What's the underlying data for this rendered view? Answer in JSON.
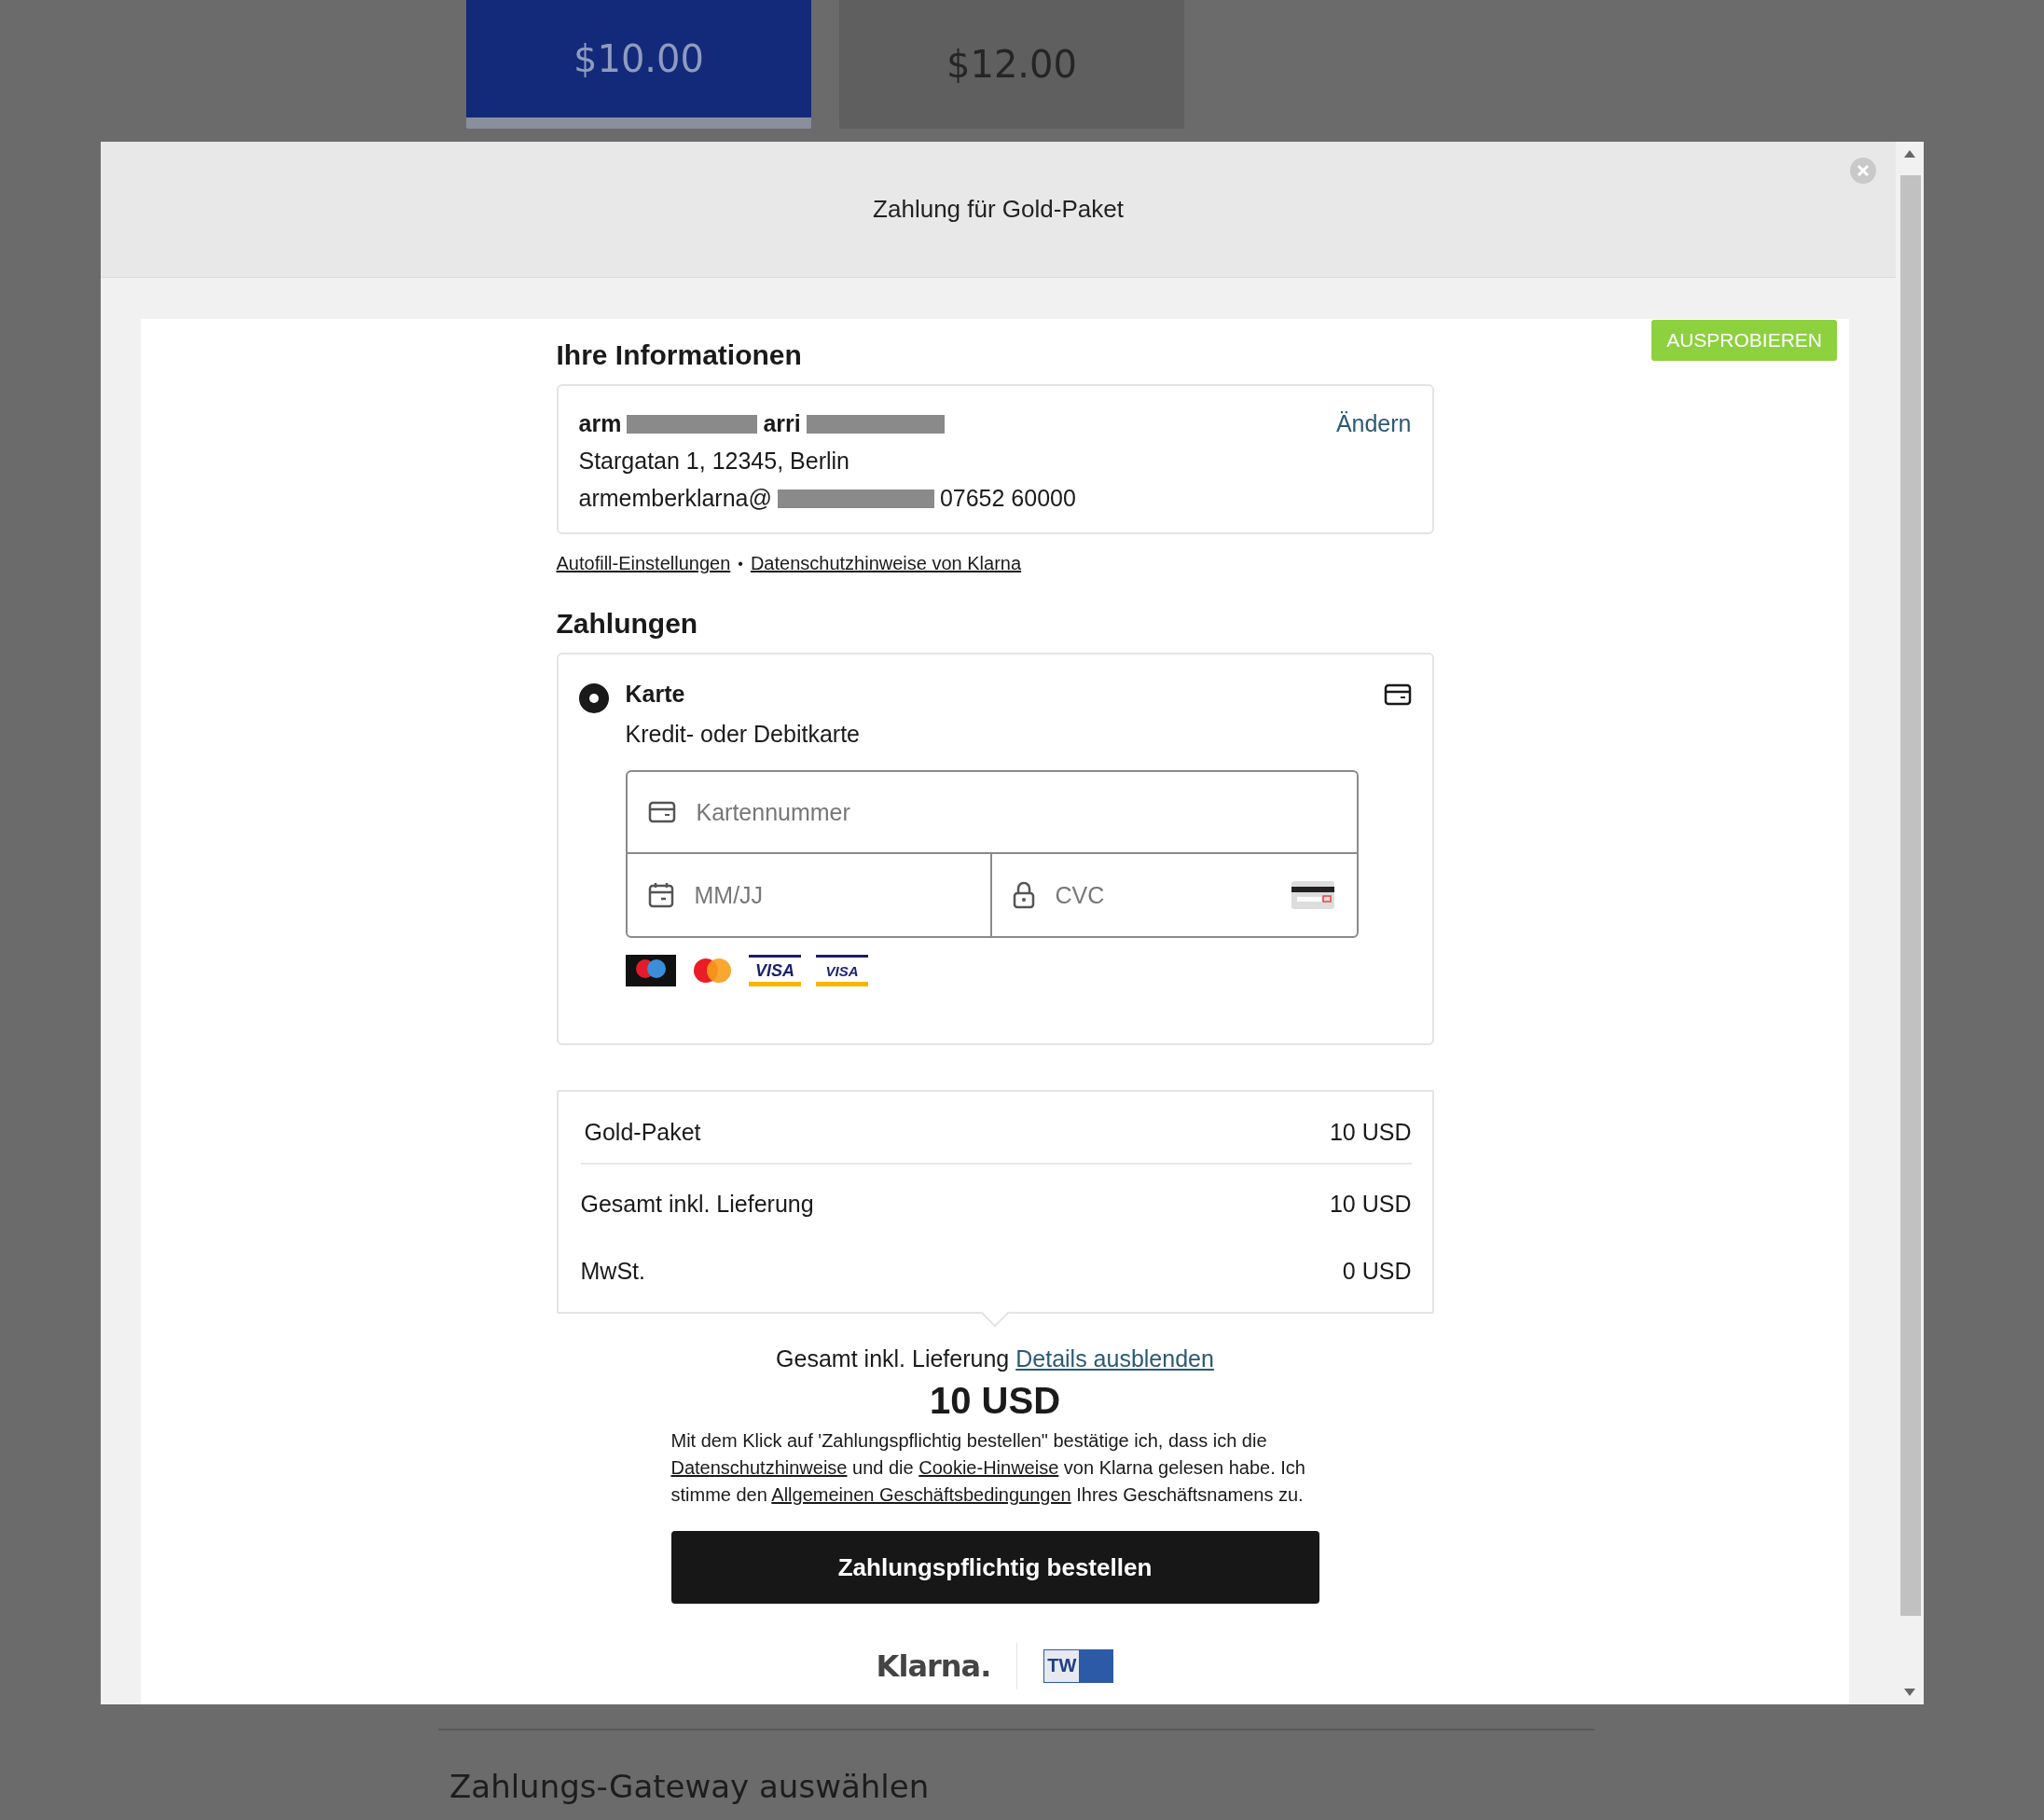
{
  "background": {
    "price_options": [
      {
        "label": "$10.00",
        "selected": true
      },
      {
        "label": "$12.00",
        "selected": false
      }
    ],
    "gateway_heading": "Zahlungs-Gateway auswählen"
  },
  "modal": {
    "title": "Zahlung für Gold-Paket",
    "badge": "AUSPROBIEREN",
    "info": {
      "heading": "Ihre Informationen",
      "name_parts": [
        {
          "kind": "text",
          "text": "arm"
        },
        {
          "kind": "redacted"
        },
        {
          "kind": "text",
          "text": "arri"
        },
        {
          "kind": "redacted"
        }
      ],
      "address": "Stargatan 1, 12345, Berlin",
      "contact_parts": [
        {
          "kind": "text",
          "text": "armemberklarna@"
        },
        {
          "kind": "redacted"
        },
        {
          "kind": "text",
          "text": "07652 60000"
        }
      ],
      "edit_link": "Ändern",
      "links": [
        "Autofill-Einstellungen",
        "Datenschutzhinweise von Klarna"
      ],
      "separator": "•"
    },
    "payments": {
      "heading": "Zahlungen",
      "methods": [
        {
          "name": "Karte",
          "description": "Kredit- oder Debitkarte",
          "selected": true
        }
      ],
      "fields": {
        "card_number": {
          "placeholder": "Kartennummer"
        },
        "expiry": {
          "placeholder": "MM/JJ"
        },
        "cvc": {
          "placeholder": "CVC"
        }
      },
      "brands": [
        {
          "kind": "maestro"
        },
        {
          "kind": "mastercard"
        },
        {
          "kind": "visa",
          "label": "VISA"
        },
        {
          "kind": "visa",
          "label": "VISA"
        }
      ]
    },
    "summary": {
      "rows": [
        {
          "label": "Gold-Paket",
          "value": "10 USD"
        },
        {
          "label": "Gesamt inkl. Lieferung",
          "value": "10 USD"
        },
        {
          "label": "MwSt.",
          "value": "0 USD"
        }
      ],
      "total_label": "Gesamt inkl. Lieferung",
      "toggle_link": "Details ausblenden",
      "total": "10 USD"
    },
    "consent": [
      {
        "kind": "text",
        "text": "Mit dem Klick auf 'Zahlungspflichtig bestellen\" bestätige ich, dass ich die "
      },
      {
        "kind": "link",
        "text": "Datenschutzhinweise"
      },
      {
        "kind": "text",
        "text": " und die "
      },
      {
        "kind": "link",
        "text": "Cookie-Hinweise"
      },
      {
        "kind": "text",
        "text": " von Klarna gelesen habe. Ich stimme den "
      },
      {
        "kind": "link",
        "text": "Allgemeinen Geschäftsbedingungen"
      },
      {
        "kind": "text",
        "text": " Ihres Geschäftsnamens zu."
      }
    ],
    "submit": "Zahlungspflichtig bestellen",
    "footer": {
      "logo": "Klarna.",
      "trust_badge": "TW"
    }
  }
}
